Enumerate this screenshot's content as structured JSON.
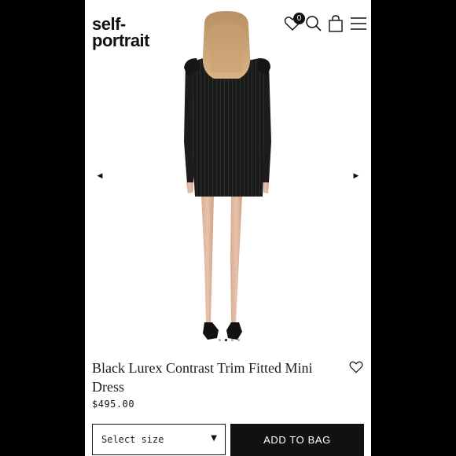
{
  "header": {
    "logo_line1": "self-",
    "logo_line2": "portrait",
    "wishlist_count": "0",
    "icons": [
      "heart-icon",
      "search-icon",
      "shopping-bag-icon",
      "menu-icon"
    ]
  },
  "gallery": {
    "prev_glyph": "◀",
    "next_glyph": "▶",
    "slide_count": 4,
    "active_slide": 2
  },
  "product": {
    "name": "Black Lurex Contrast Trim Fitted Mini Dress",
    "price": "$495.00"
  },
  "purchase": {
    "size_placeholder": "Select size",
    "caret_glyph": "▼",
    "add_to_bag_label": "ADD TO BAG"
  },
  "colors": {
    "page_bg": "#ffffff",
    "frame_bg": "#000000",
    "button_bg": "#111111",
    "button_text": "#ffffff"
  }
}
